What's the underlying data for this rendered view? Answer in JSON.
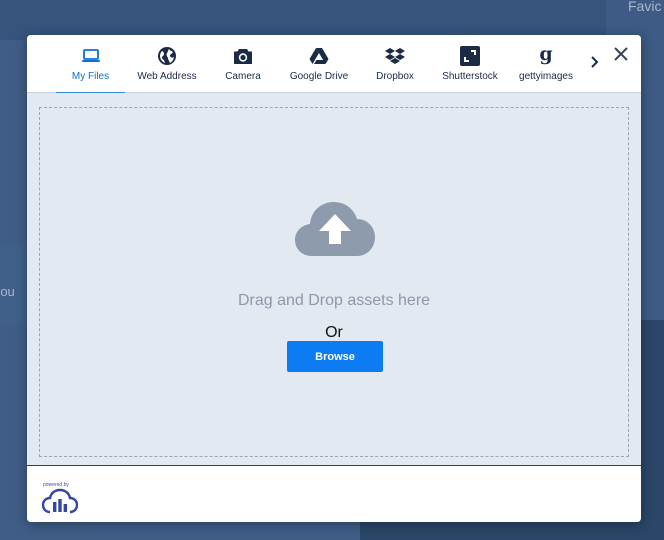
{
  "background": {
    "right_text": "Favic",
    "left_text": "rou"
  },
  "tabs": [
    {
      "label": "My Files",
      "icon": "laptop-icon",
      "active": true
    },
    {
      "label": "Web Address",
      "icon": "globe-icon",
      "active": false
    },
    {
      "label": "Camera",
      "icon": "camera-icon",
      "active": false
    },
    {
      "label": "Google Drive",
      "icon": "google-drive-icon",
      "active": false
    },
    {
      "label": "Dropbox",
      "icon": "dropbox-icon",
      "active": false
    },
    {
      "label": "Shutterstock",
      "icon": "shutterstock-icon",
      "active": false
    },
    {
      "label": "gettyimages",
      "icon": "gettyimages-icon",
      "active": false
    }
  ],
  "dropzone": {
    "drag_text": "Drag and Drop assets here",
    "or_text": "Or",
    "browse_label": "Browse"
  },
  "footer": {
    "powered_by": "powered by"
  },
  "colors": {
    "accent": "#0d7bf2",
    "active_tab": "#0c6fd6",
    "icon_dark": "#1b2b45",
    "dropzone_bg": "#e3e9f1",
    "cloud": "#8d9bad"
  }
}
